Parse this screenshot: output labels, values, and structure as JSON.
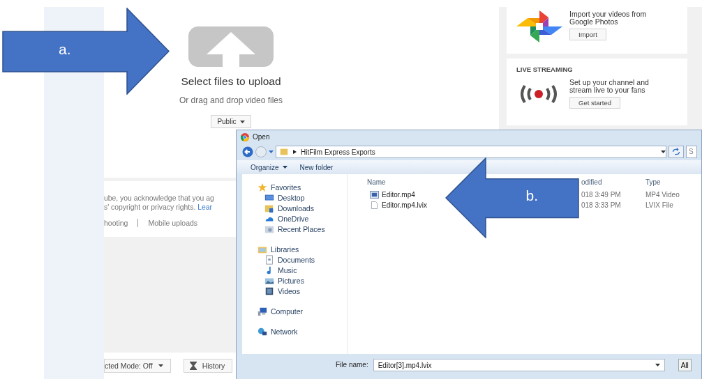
{
  "upload": {
    "title": "Select files to upload",
    "subtitle": "Or drag and drop video files",
    "privacy": "Public"
  },
  "legal": {
    "line_1": "ube, you acknowledge that you ag",
    "line_2": "s' copyright or privacy rights.",
    "link": "Lear",
    "links": [
      "hooting",
      "Mobile uploads"
    ]
  },
  "footer_buttons": [
    {
      "kind": "dropdown",
      "label": "cted Mode: Off"
    },
    {
      "kind": "history",
      "label": "History"
    }
  ],
  "side_cards": [
    {
      "kind": "import",
      "text": "Import your videos from Google Photos",
      "button": "Import"
    },
    {
      "kind": "live",
      "heading": "LIVE STREAMING",
      "text": "Set up your channel and stream live to your fans",
      "button": "Get started"
    }
  ],
  "dialog": {
    "title": "Open",
    "path": "HitFilm Express Exports",
    "search": "S",
    "toolbar": [
      {
        "kind": "menu",
        "label": "Organize"
      },
      {
        "kind": "plain",
        "label": "New folder"
      }
    ],
    "nav": [
      {
        "kind": "favorites",
        "label": "Favorites",
        "children": [
          {
            "kind": "desktop",
            "label": "Desktop"
          },
          {
            "kind": "downloads",
            "label": "Downloads"
          },
          {
            "kind": "cloud",
            "label": "OneDrive"
          },
          {
            "kind": "recent",
            "label": "Recent Places"
          }
        ]
      },
      {
        "kind": "libraries",
        "label": "Libraries",
        "children": [
          {
            "kind": "document",
            "label": "Documents"
          },
          {
            "kind": "music",
            "label": "Music"
          },
          {
            "kind": "pictures",
            "label": "Pictures"
          },
          {
            "kind": "videos",
            "label": "Videos"
          }
        ]
      },
      {
        "kind": "computer",
        "label": "Computer"
      },
      {
        "kind": "network",
        "label": "Network"
      }
    ],
    "columns": [
      "Name",
      "odified",
      "Type"
    ],
    "files": [
      {
        "kind": "video",
        "name": "Editor.mp4",
        "modified": "018 3:49 PM",
        "type": "MP4 Video"
      },
      {
        "kind": "file",
        "name": "Editor.mp4.lvix",
        "modified": "018 3:33 PM",
        "type": "LVIX File"
      }
    ],
    "file_name_label": "File name:",
    "file_name": "Editor[3].mp4.lvix",
    "filter": "All"
  },
  "callouts": [
    {
      "label": "a.",
      "kind": "right"
    },
    {
      "label": "b.",
      "kind": "left"
    }
  ]
}
